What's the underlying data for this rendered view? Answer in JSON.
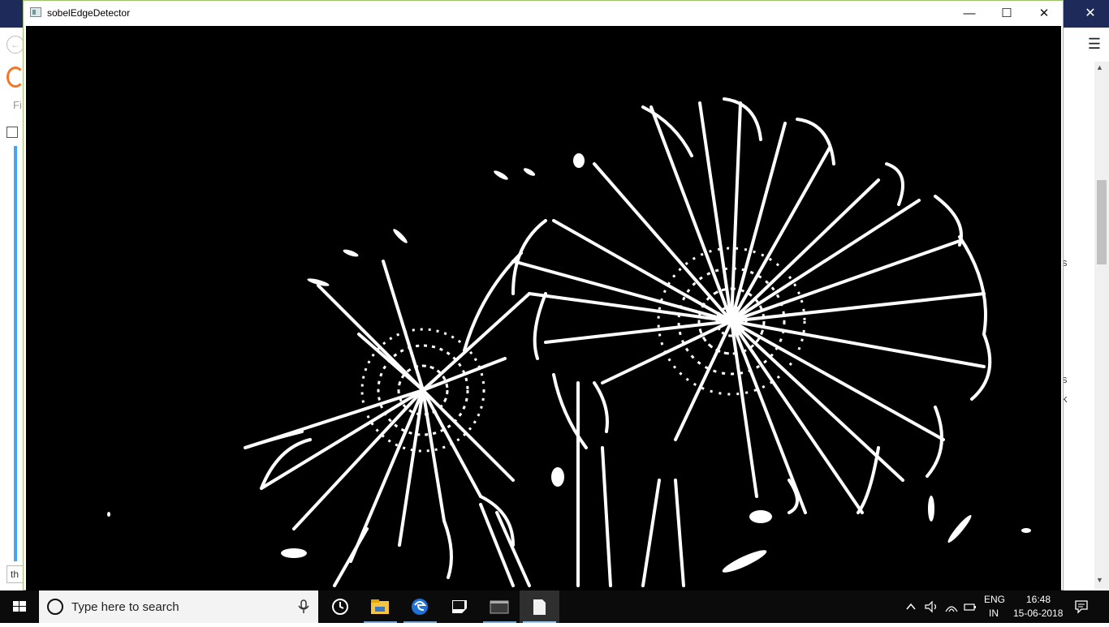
{
  "background_window": {
    "cell_text": "th",
    "partial_text_top": "Fi",
    "right_fragments": [
      "s",
      "s",
      "k"
    ]
  },
  "cv_window": {
    "title": "sobelEdgeDetector",
    "minimize_glyph": "—",
    "maximize_glyph": "☐",
    "close_glyph": "✕"
  },
  "taskbar": {
    "search_placeholder": "Type here to search",
    "language_line1": "ENG",
    "language_line2": "IN",
    "time": "16:48",
    "date": "15-06-2018"
  },
  "colors": {
    "taskbar_bg": "#0b0b0b",
    "canvas_bg": "#000000",
    "edge_color": "#ffffff",
    "bg_title_bar": "#1e2a5a",
    "selection_bar": "#42a5f5"
  }
}
